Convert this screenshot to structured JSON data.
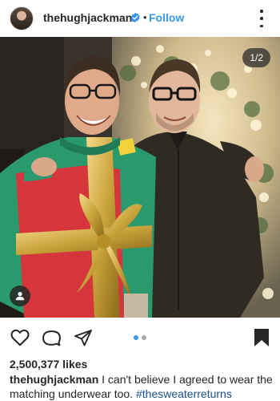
{
  "header": {
    "username": "thehughjackman",
    "verified": true,
    "separator": "•",
    "follow_label": "Follow"
  },
  "photo": {
    "counter": "1/2",
    "description_icons": [
      "user-tag-icon"
    ]
  },
  "actions": {
    "icons": [
      "heart-icon",
      "comment-icon",
      "share-icon",
      "bookmark-icon"
    ],
    "carousel_total": 2,
    "carousel_active": 1
  },
  "post": {
    "likes": "2,500,377 likes",
    "caption_user": "thehughjackman",
    "caption_text": "I can't believe I agreed to wear the matching underwear too.",
    "hashtag": "#thesweaterreturns"
  },
  "colors": {
    "link_blue": "#3897f0",
    "hashtag_blue": "#1a4e8a",
    "text": "#262626"
  }
}
